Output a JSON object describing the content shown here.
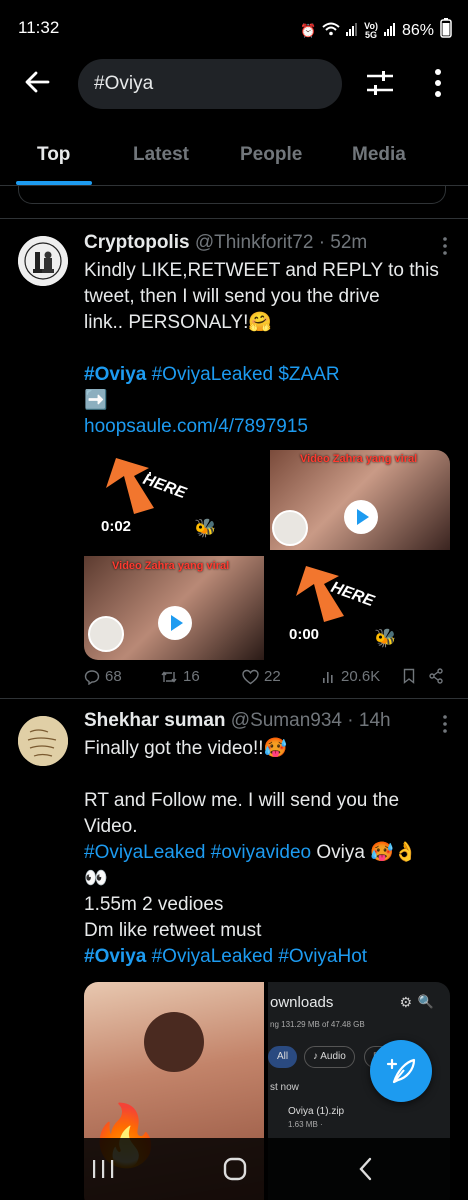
{
  "status_bar": {
    "time": "11:32",
    "net_top": "Vo)",
    "net_bottom": "5G",
    "battery": "86%"
  },
  "search": {
    "query": "#Oviya",
    "back_icon": "arrow-left-icon",
    "filter_icon": "sliders-icon",
    "more_icon": "more-vertical-icon"
  },
  "tabs": [
    {
      "label": "Top",
      "active": true
    },
    {
      "label": "Latest",
      "active": false
    },
    {
      "label": "People",
      "active": false
    },
    {
      "label": "Media",
      "active": false
    }
  ],
  "tweets": [
    {
      "name": "Cryptopolis",
      "handle": "@Thinkforit72",
      "time": "52m",
      "line1": "Kindly LIKE,RETWEET and REPLY to this",
      "line2": "tweet, then I will send you the drive",
      "line3": "link.. PERSONALY!🤗",
      "tag1": "#Oviya",
      "tag2": "#OviyaLeaked",
      "tag3": "$ZAAR",
      "arrow": "➡️",
      "link": "hoopsaule.com/4/7897915",
      "media": {
        "tile1_duration": "0:02",
        "tile1_text": "HERE",
        "tile2_caption": "Video Zahra yang viral",
        "tile3_caption": "Video Zahra yang viral",
        "tile4_duration": "0:00",
        "tile4_text": "HERE"
      },
      "replies": "68",
      "retweets": "16",
      "likes": "22",
      "views": "20.6K"
    },
    {
      "name": "Shekhar suman",
      "handle": "@Suman934",
      "time": "14h",
      "line1": "Finally got the video!!🥵",
      "line2": "RT and Follow me. I will send you the",
      "line3": "Video.",
      "tagsA1": "#OviyaLeaked",
      "tagsA2": "#oviyavideo",
      "tagsA3": "Oviya 🥵👌",
      "eyes": "👀",
      "line4": "1.55m 2 vedioes",
      "line5": "Dm like retweet must",
      "tagsB1": "#Oviya",
      "tagsB2": "#OviyaLeaked",
      "tagsB3": "#OviyaHot",
      "downloads": {
        "title": "ownloads",
        "sub": "ng 131.29 MB of 47.48 GB",
        "chip_all": "All",
        "chip_audio": "Audio",
        "chip_c": "C",
        "section": "st now",
        "file": "Oviya (1).zip",
        "size": "1.63 MB ·"
      }
    }
  ],
  "colors": {
    "accent": "#1d9bf0",
    "background": "#000000",
    "muted": "#71767b",
    "divider": "#2f3336"
  }
}
